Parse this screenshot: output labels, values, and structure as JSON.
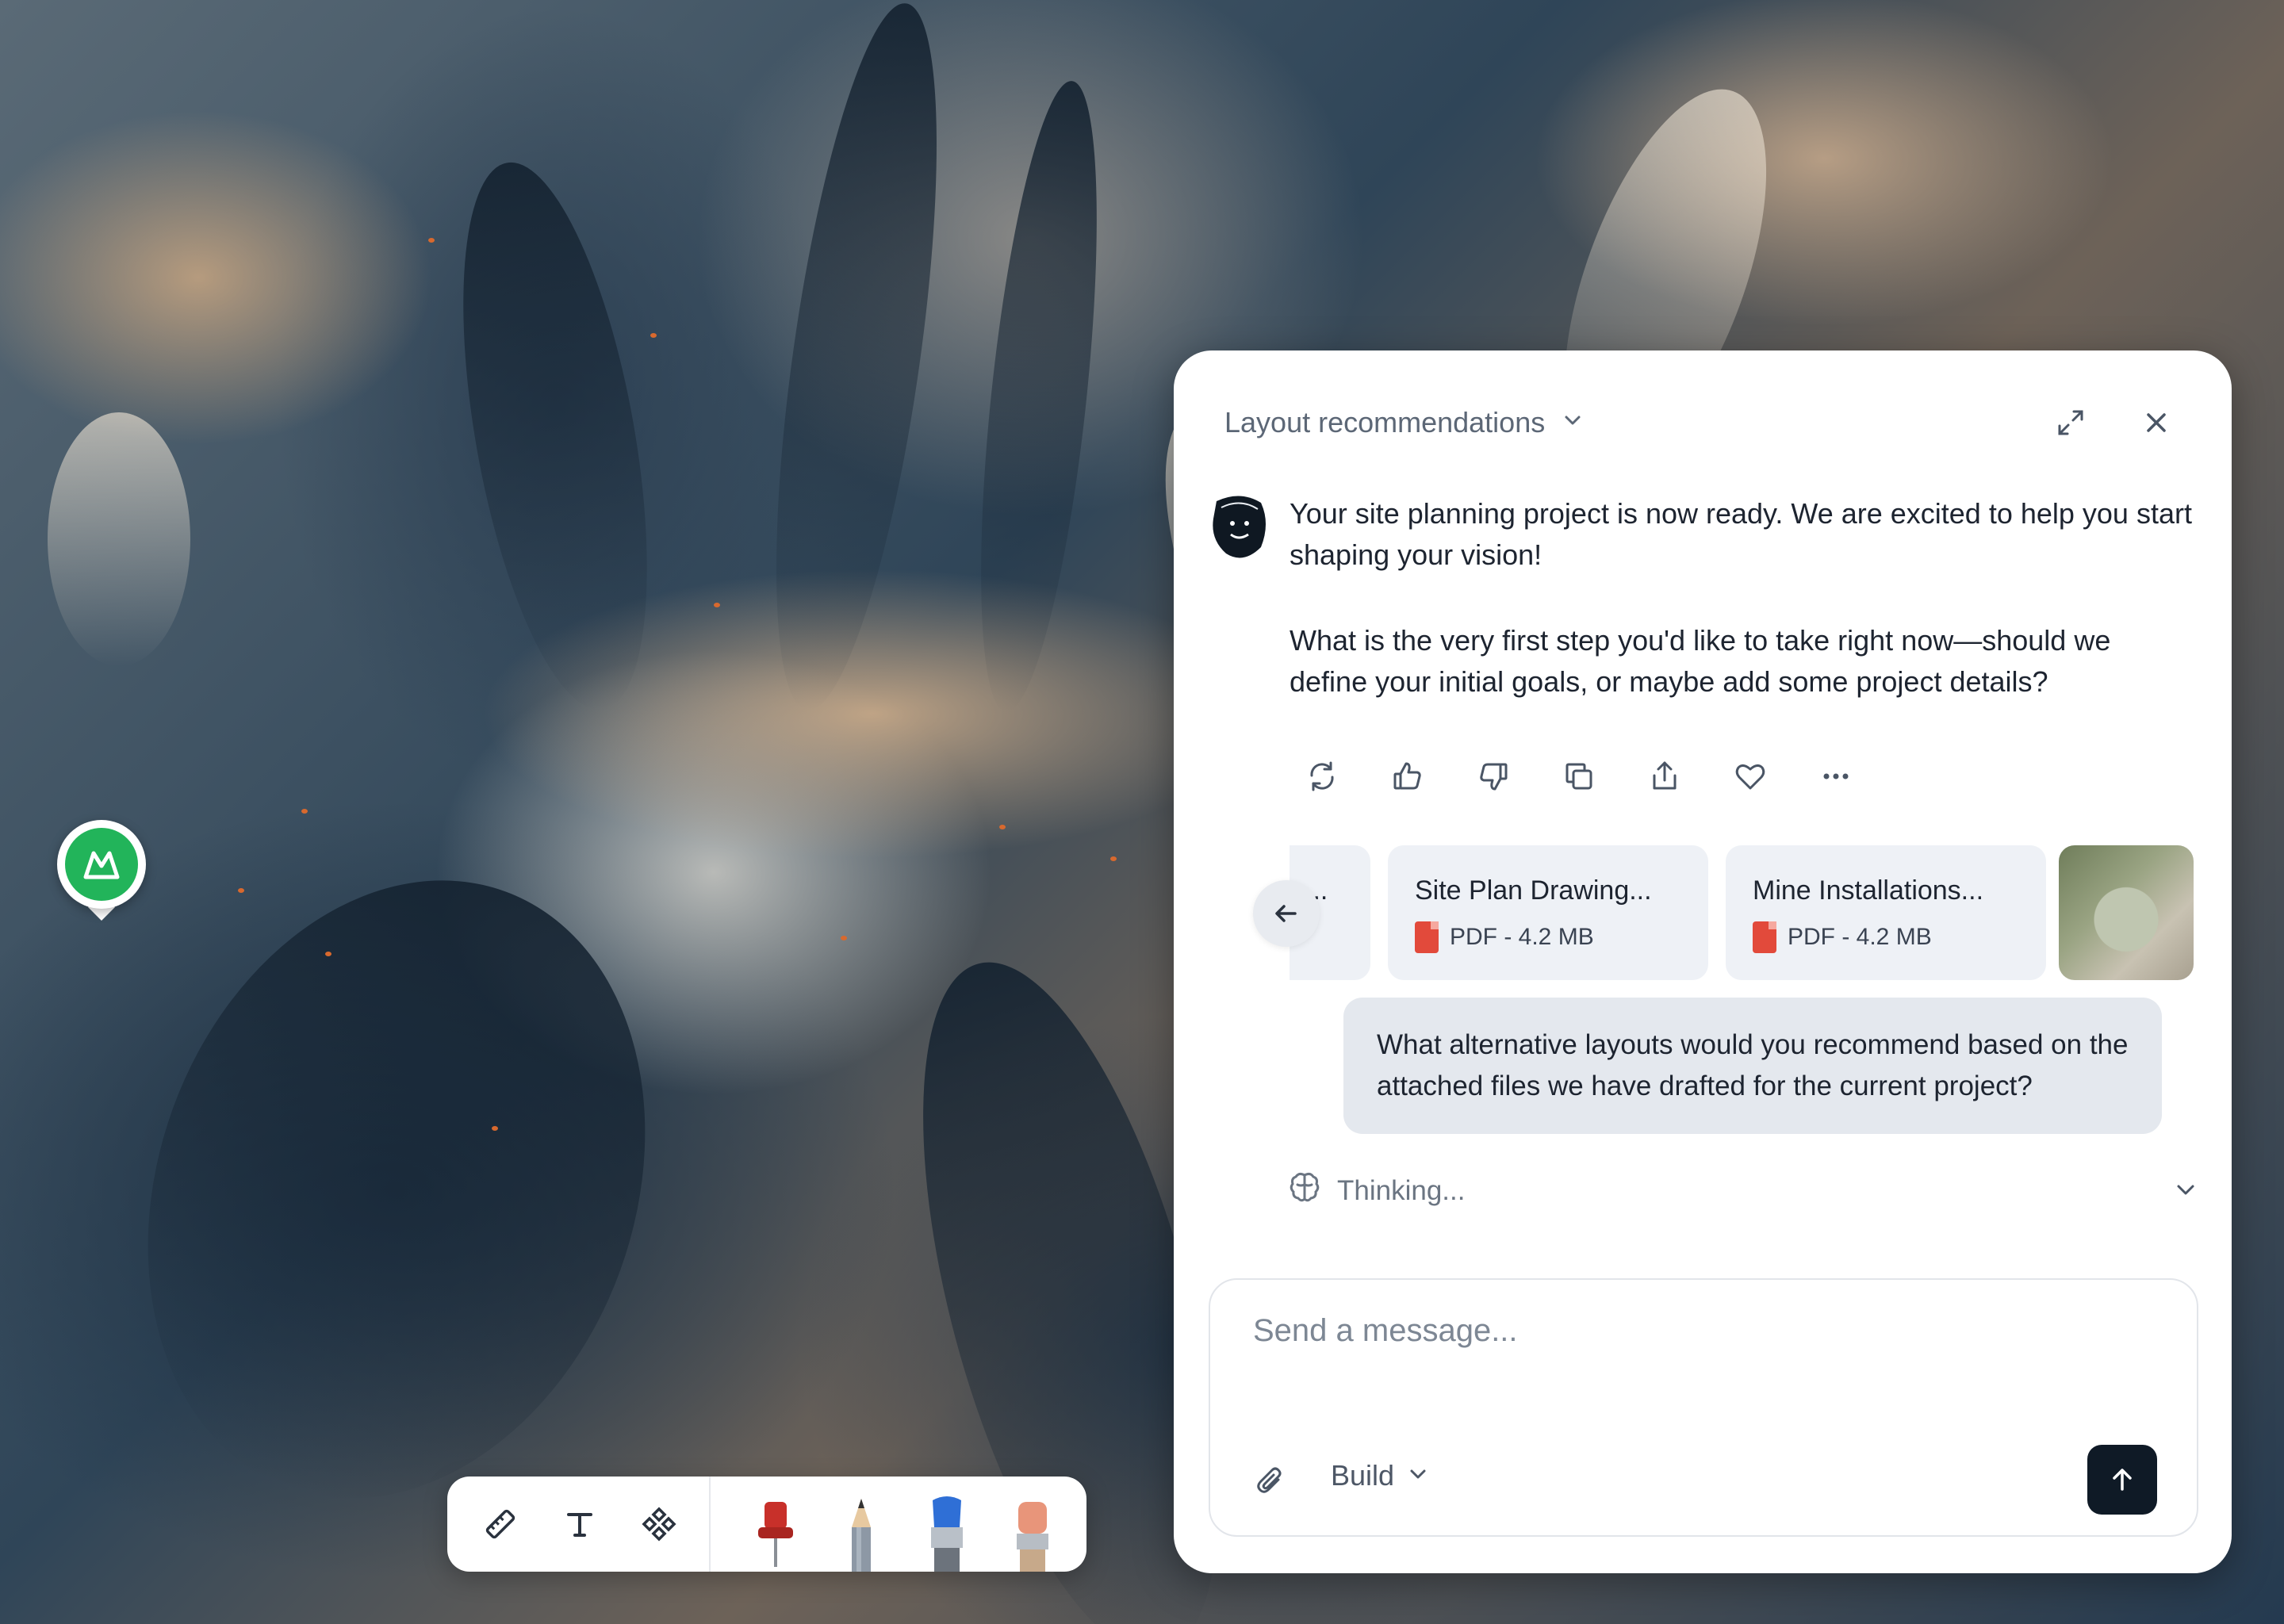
{
  "map": {
    "pin_color": "#22b45a",
    "pin_icon": "mountain-icon"
  },
  "toolbar": {
    "tools": [
      "ruler-icon",
      "text-icon",
      "components-icon"
    ],
    "drawing_tools": [
      "pushpin",
      "pencil",
      "paintbrush",
      "eraser"
    ]
  },
  "chat": {
    "title": "Layout recommendations",
    "assistant_message": {
      "paragraph_1": "Your site planning project is now ready. We are excited to help you start shaping your vision!",
      "paragraph_2": "What is the very first step you'd like to take right now—should we define your initial goals, or maybe add some project details?"
    },
    "actions": [
      "regenerate-icon",
      "thumbs-up-icon",
      "thumbs-down-icon",
      "copy-icon",
      "share-icon",
      "heart-icon",
      "more-icon"
    ],
    "attachments": [
      {
        "name": "...",
        "meta": ""
      },
      {
        "name": "Site Plan Drawing...",
        "meta": "PDF - 4.2 MB"
      },
      {
        "name": "Mine Installations...",
        "meta": "PDF - 4.2 MB"
      }
    ],
    "user_message": "What alternative layouts would you recommend based on the attached files we have drafted for the current project?",
    "thinking_label": "Thinking...",
    "composer": {
      "placeholder": "Send a message...",
      "mode": "Build"
    }
  }
}
